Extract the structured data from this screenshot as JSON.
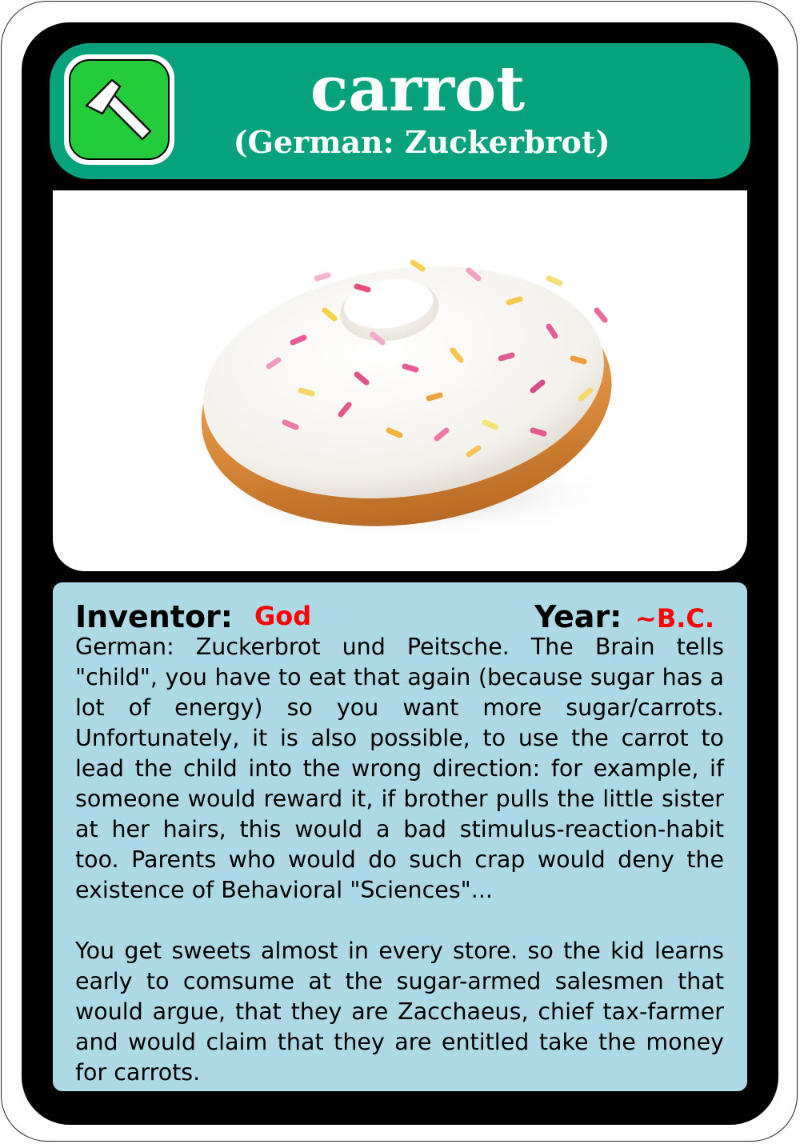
{
  "card": {
    "title": "carrot",
    "subtitle": "(German: Zuckerbrot)",
    "category_icon": "hammer-icon",
    "colors": {
      "header": "#06a17d",
      "icon_background": "#23cc3b",
      "text_panel": "#add8e6",
      "highlight": "#ff0000"
    }
  },
  "image": {
    "depicts": "donut-with-sprinkles"
  },
  "details": {
    "inventor_label": "Inventor:",
    "inventor_value": "God",
    "year_label": "Year:",
    "year_value": "~B.C."
  },
  "description": {
    "paragraph_1": "German: Zuckerbrot und Peitsche. The Brain tells \"child\", you have to eat that again (because sugar has a lot of energy) so you want more sugar/carrots. Unfortunately, it is also possible, to use the carrot to lead the child into the wrong direction: for example, if someone would reward it, if brother pulls the little sister at her hairs, this would a bad stimulus-reaction-habit too. Parents who would do such crap would deny the existence of Behavioral \"Sciences\"...",
    "paragraph_2": "You get sweets almost in every store. so the kid learns early to comsume at the sugar-armed salesmen that would argue, that they are  Zacchaeus, chief tax-farmer and would claim that they are entitled take the money for carrots."
  }
}
